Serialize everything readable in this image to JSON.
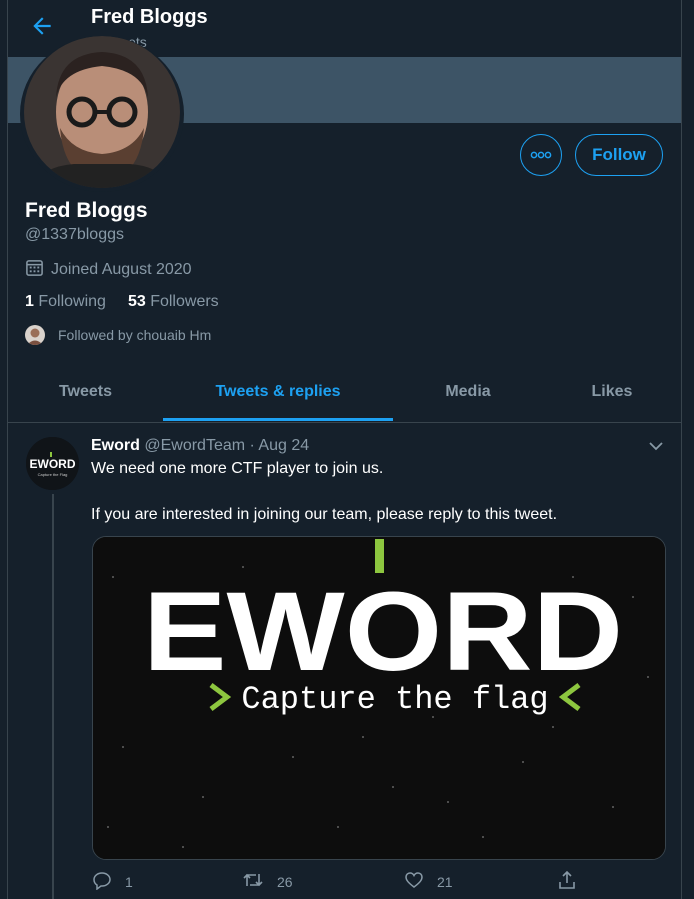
{
  "header": {
    "name": "Fred Bloggs",
    "tweet_count": "3 Tweets"
  },
  "profile": {
    "name": "Fred Bloggs",
    "handle": "@1337bloggs",
    "joined": "Joined August 2020",
    "following_count": "1",
    "following_label": "Following",
    "followers_count": "53",
    "followers_label": "Followers",
    "followed_by": "Followed by chouaib Hm",
    "follow_label": "Follow"
  },
  "tabs": [
    {
      "label": "Tweets"
    },
    {
      "label": "Tweets & replies"
    },
    {
      "label": "Media"
    },
    {
      "label": "Likes"
    }
  ],
  "active_tab": "Tweets & replies",
  "tweet": {
    "author": "Eword",
    "handle": "@EwordTeam",
    "date": "· Aug 24",
    "line1": "We need one more CTF player to join us.",
    "line2": "If you are interested in joining our team, please reply to this tweet.",
    "avatar_text": "EWORD",
    "avatar_sub": "Capture the Flag",
    "media_title": "EWORD",
    "media_subtitle": "Capture the flag",
    "replies": "1",
    "retweets": "26",
    "likes": "21"
  },
  "colors": {
    "accent": "#1da1f2",
    "background": "#15202b",
    "muted": "#8899a6",
    "border": "#38444d",
    "banner": "#3d5466",
    "brand_green": "#8dc63f"
  },
  "icons": [
    "back-arrow-icon",
    "calendar-icon",
    "more-icon",
    "chevron-down-icon",
    "reply-icon",
    "retweet-icon",
    "like-icon",
    "share-icon"
  ]
}
